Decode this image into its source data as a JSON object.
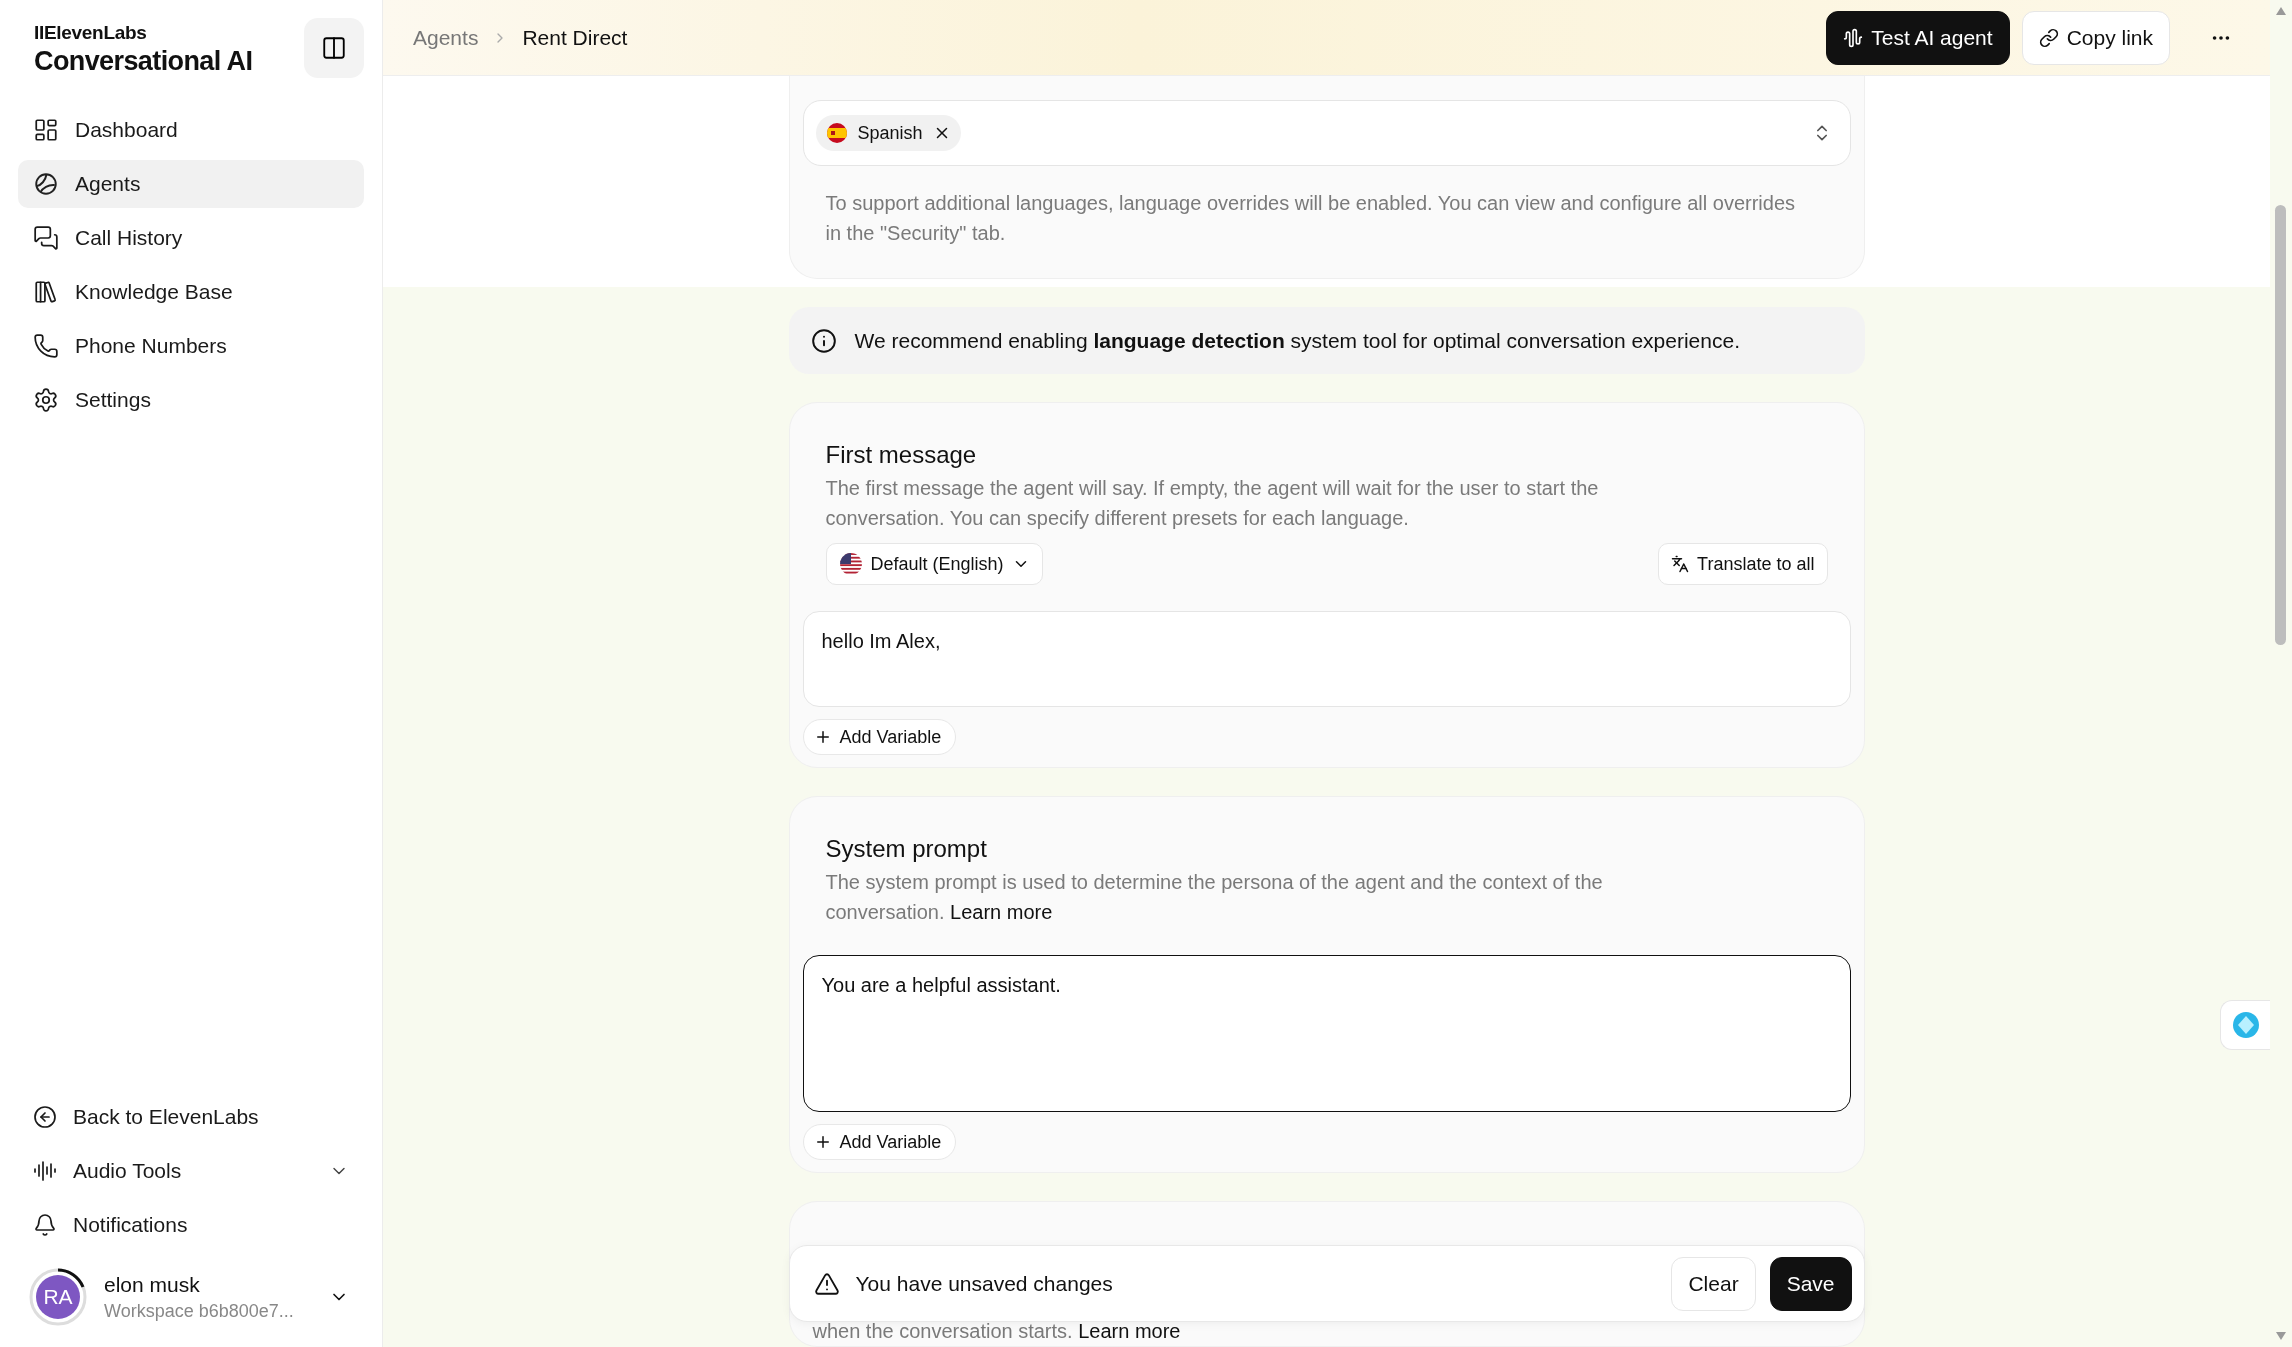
{
  "sidebar": {
    "brand": "IIElevenLabs",
    "product": "Conversational AI",
    "nav": [
      {
        "label": "Dashboard",
        "selected": false
      },
      {
        "label": "Agents",
        "selected": true
      },
      {
        "label": "Call History",
        "selected": false
      },
      {
        "label": "Knowledge Base",
        "selected": false
      },
      {
        "label": "Phone Numbers",
        "selected": false
      },
      {
        "label": "Settings",
        "selected": false
      }
    ],
    "bottom": [
      {
        "kind": "link",
        "label": "Back to ElevenLabs"
      },
      {
        "kind": "expandable",
        "label": "Audio Tools",
        "expanded": false
      },
      {
        "kind": "notifications",
        "label": "Notifications"
      }
    ],
    "user": {
      "initials": "RA",
      "name": "elon musk",
      "workspace": "Workspace b6b800e7..."
    }
  },
  "topbar": {
    "breadcrumbs": [
      "Agents",
      "Rent Direct"
    ],
    "buttons": [
      {
        "kind": "primary",
        "label": "Test AI agent"
      },
      {
        "kind": "secondary",
        "label": "Copy link"
      }
    ]
  },
  "languages": {
    "tags": [
      {
        "label": "Spanish"
      }
    ],
    "note": "To support additional languages, language overrides will be enabled. You can view and configure all overrides in the \"Security\" tab."
  },
  "info_banner": "We recommend enabling **language detection** system tool for optimal conversation experience.",
  "first_message": {
    "title": "First message",
    "description": "The first message the agent will say. If empty, the agent will wait for the user to start the conversation. You can specify different presets for each language.",
    "language": "Default (English)",
    "translate": "Translate to all",
    "value": "hello Im Alex,",
    "focused": false,
    "add_variable": "Add Variable"
  },
  "system_prompt": {
    "title": "System prompt",
    "description": "The system prompt is used to determine the persona of the agent and the context of the conversation.",
    "link": "Learn more",
    "value": "You are a helpful assistant.",
    "focused": true,
    "add_variable": "Add Variable"
  },
  "next_section": {
    "description": "when the conversation starts.",
    "link": "Learn more"
  },
  "unsaved_bar": {
    "message": "You have unsaved changes",
    "buttons": [
      {
        "kind": "secondary",
        "label": "Clear"
      },
      {
        "kind": "primary",
        "label": "Save"
      }
    ]
  }
}
